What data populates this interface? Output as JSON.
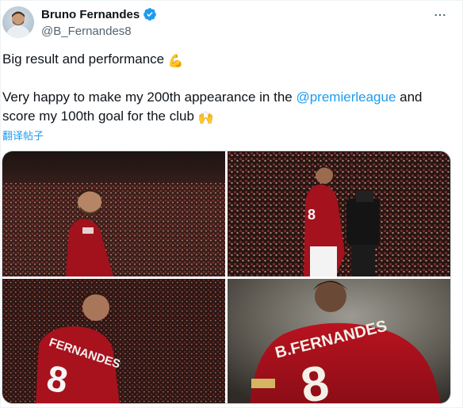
{
  "author": {
    "display_name": "Bruno Fernandes",
    "handle": "@B_Fernandes8",
    "verified": true
  },
  "tweet": {
    "line1_text": "Big result and performance ",
    "line1_emoji": "💪",
    "line2_before": "Very happy to make my 200th appearance in the ",
    "line2_mention": "@premierleague",
    "line2_after": " and score my 100th goal for the club ",
    "line2_emoji": "🙌",
    "translate_label": "翻译帖子"
  },
  "photos": {
    "shirt_name": "B.FERNANDES",
    "shirt_number": "8"
  },
  "colors": {
    "accent": "#1d9bf0",
    "text": "#0f1419",
    "secondary": "#536471",
    "kit_red": "#b0101c"
  },
  "icons": {
    "verified": "verified-badge-icon",
    "more": "more-options-icon"
  }
}
